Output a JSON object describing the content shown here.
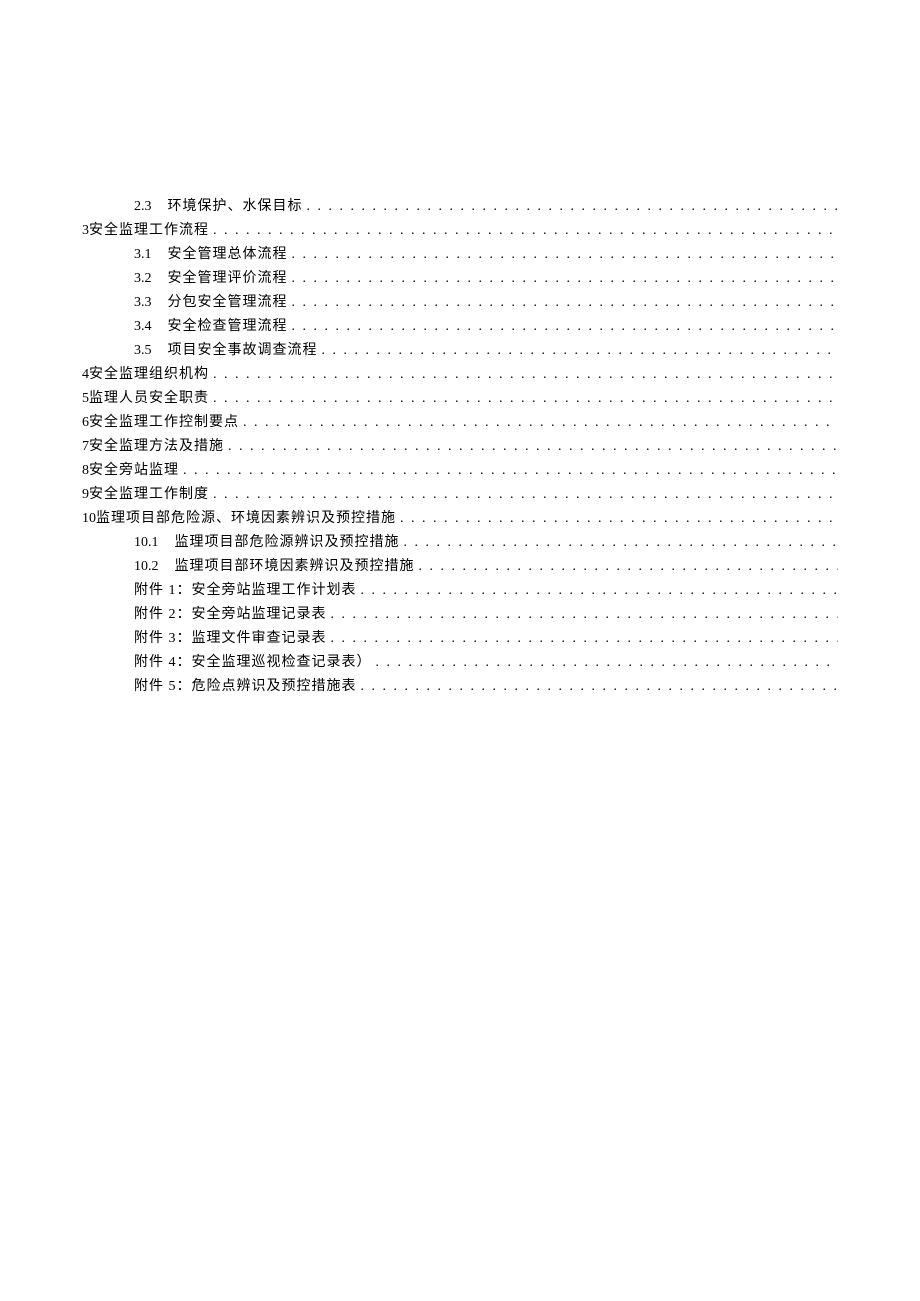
{
  "toc": [
    {
      "level": 2,
      "num": "2.3",
      "title": "环境保护、水保目标"
    },
    {
      "level": 1,
      "num": "3",
      "title": "安全监理工作流程"
    },
    {
      "level": 2,
      "num": "3.1",
      "title": "安全管理总体流程"
    },
    {
      "level": 2,
      "num": "3.2",
      "title": "安全管理评价流程"
    },
    {
      "level": 2,
      "num": "3.3",
      "title": "分包安全管理流程"
    },
    {
      "level": 2,
      "num": "3.4",
      "title": "安全检查管理流程"
    },
    {
      "level": 2,
      "num": "3.5",
      "title": "项目安全事故调查流程"
    },
    {
      "level": 1,
      "num": "4",
      "title": "安全监理组织机构"
    },
    {
      "level": 1,
      "num": "5",
      "title": "监理人员安全职责"
    },
    {
      "level": 1,
      "num": "6",
      "title": "安全监理工作控制要点"
    },
    {
      "level": 1,
      "num": "7",
      "title": "安全监理方法及措施"
    },
    {
      "level": 1,
      "num": "8",
      "title": "安全旁站监理"
    },
    {
      "level": 1,
      "num": "9",
      "title": "安全监理工作制度"
    },
    {
      "level": 1,
      "num": "10",
      "title": "监理项目部危险源、环境因素辨识及预控措施"
    },
    {
      "level": 2,
      "num": "10.1",
      "title": "监理项目部危险源辨识及预控措施"
    },
    {
      "level": 2,
      "num": "10.2",
      "title": "监理项目部环境因素辨识及预控措施"
    },
    {
      "level": 2,
      "num": "",
      "title": "附件 1：安全旁站监理工作计划表"
    },
    {
      "level": 2,
      "num": "",
      "title": "附件 2：安全旁站监理记录表"
    },
    {
      "level": 2,
      "num": "",
      "title": "附件 3：监理文件审查记录表"
    },
    {
      "level": 2,
      "num": "",
      "title": "附件 4：安全监理巡视检查记录表）"
    },
    {
      "level": 2,
      "num": "",
      "title": "附件 5：危险点辨识及预控措施表"
    }
  ],
  "dots": ". . . . . . . . . . . . . . . . . . . . . . . . . . . . . . . . . . . . . . . . . . . . . . . . . . . . . . . . . . . . . . . . . . . . . . . . . . . . . . . . . . . . . . . . . . . . . . . . . . . . . . . . . . . . . . . . . . . . . . . . . . . . . ."
}
